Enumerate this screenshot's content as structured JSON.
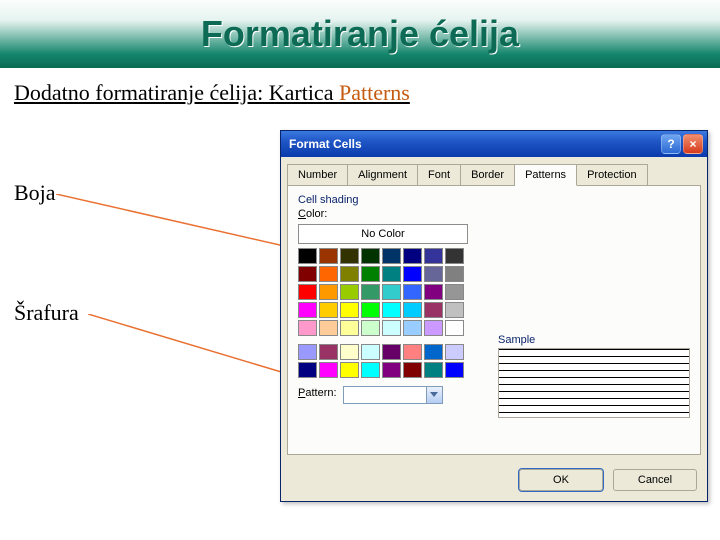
{
  "banner": {
    "title": "Formatiranje ćelija"
  },
  "subtitle": {
    "prefix": "Dodatno formatiranje ćelija: Kartica ",
    "keyword": "Patterns"
  },
  "labels": {
    "boja": "Boja",
    "srafura": "Šrafura"
  },
  "dialog": {
    "title": "Format Cells",
    "tabs": [
      "Number",
      "Alignment",
      "Font",
      "Border",
      "Patterns",
      "Protection"
    ],
    "active_tab": "Patterns",
    "group_label": "Cell shading",
    "color_label_pre": "C",
    "color_label_post": "olor:",
    "no_color": "No Color",
    "pattern_label_pre": "P",
    "pattern_label_post": "attern:",
    "sample_label": "Sample",
    "ok": "OK",
    "cancel": "Cancel"
  },
  "palette_main": [
    "#000000",
    "#993300",
    "#333300",
    "#003300",
    "#003366",
    "#000080",
    "#333399",
    "#333333",
    "#800000",
    "#ff6600",
    "#808000",
    "#008000",
    "#008080",
    "#0000ff",
    "#666699",
    "#808080",
    "#ff0000",
    "#ff9900",
    "#99cc00",
    "#339966",
    "#33cccc",
    "#3366ff",
    "#800080",
    "#969696",
    "#ff00ff",
    "#ffcc00",
    "#ffff00",
    "#00ff00",
    "#00ffff",
    "#00ccff",
    "#993366",
    "#c0c0c0",
    "#ff99cc",
    "#ffcc99",
    "#ffff99",
    "#ccffcc",
    "#ccffff",
    "#99ccff",
    "#cc99ff",
    "#ffffff"
  ],
  "palette_extra": [
    "#9999ff",
    "#993366",
    "#ffffcc",
    "#ccffff",
    "#660066",
    "#ff8080",
    "#0066cc",
    "#ccccff",
    "#000080",
    "#ff00ff",
    "#ffff00",
    "#00ffff",
    "#800080",
    "#800000",
    "#008080",
    "#0000ff"
  ]
}
